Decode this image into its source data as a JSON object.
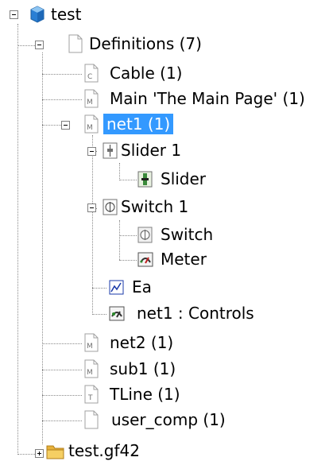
{
  "tree": {
    "root": {
      "label": "test",
      "icon": "cube-icon"
    },
    "definitions": {
      "label": "Definitions (7)",
      "icon": "document-icon"
    },
    "items": [
      {
        "label": "Cable (1)",
        "icon": "component-c-icon",
        "badge": "C"
      },
      {
        "label": "Main 'The Main Page' (1)",
        "icon": "component-m-icon",
        "badge": "M"
      },
      {
        "label": "net1 (1)",
        "icon": "component-m-icon",
        "badge": "M",
        "selected": true
      },
      {
        "label": "Slider 1",
        "icon": "slider-group-icon"
      },
      {
        "label": "Slider",
        "icon": "slider-icon"
      },
      {
        "label": "Switch 1",
        "icon": "switch-group-icon"
      },
      {
        "label": "Switch",
        "icon": "switch-icon"
      },
      {
        "label": "Meter",
        "icon": "meter-icon"
      },
      {
        "label": "Ea",
        "icon": "graph-icon"
      },
      {
        "label": "net1 : Controls",
        "icon": "controls-icon"
      },
      {
        "label": "net2 (1)",
        "icon": "component-m-icon",
        "badge": "M"
      },
      {
        "label": "sub1 (1)",
        "icon": "component-m-icon",
        "badge": "M"
      },
      {
        "label": "TLine (1)",
        "icon": "component-t-icon",
        "badge": "T"
      },
      {
        "label": "user_comp (1)",
        "icon": "document-icon"
      }
    ],
    "folder": {
      "label": "test.gf42",
      "icon": "folder-icon"
    }
  },
  "colors": {
    "selection": "#3399ff",
    "cube": "#2a7fd4",
    "folder": "#e8b23a"
  }
}
